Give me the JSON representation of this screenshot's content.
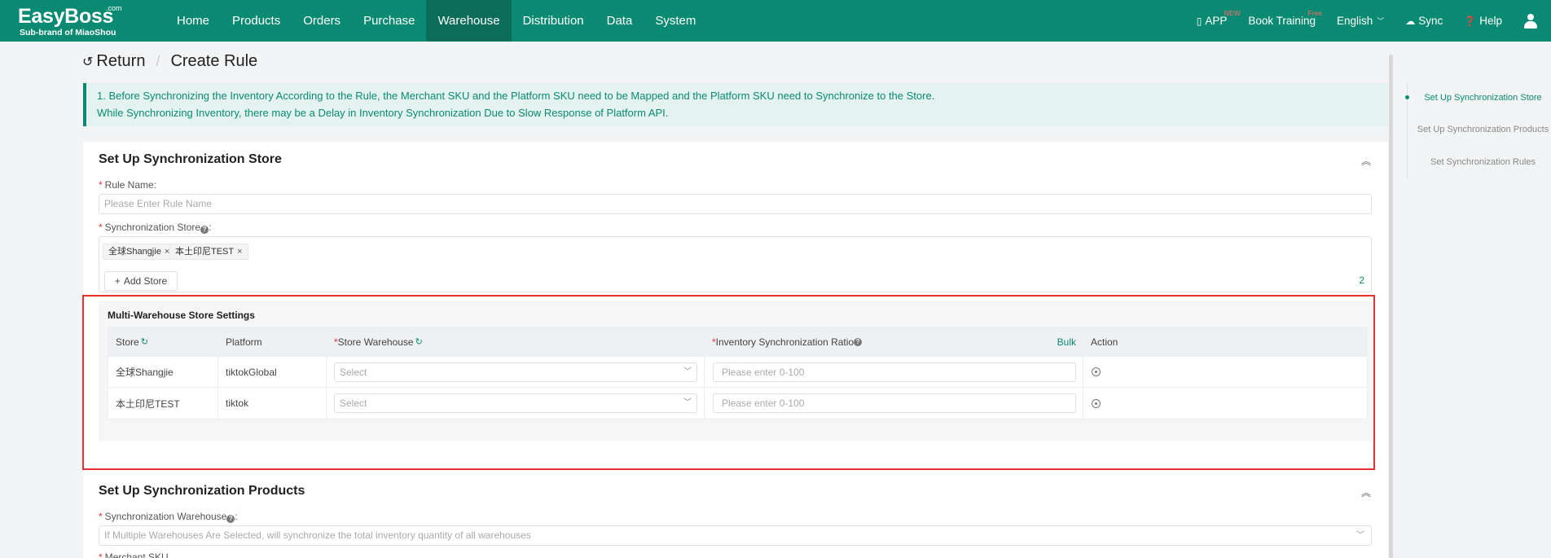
{
  "header": {
    "logo_brand": "EasyBoss",
    "logo_com": ".com",
    "logo_sub": "Sub-brand of MiaoShou",
    "nav": [
      "Home",
      "Products",
      "Orders",
      "Purchase",
      "Warehouse",
      "Distribution",
      "Data",
      "System"
    ],
    "active_nav": "Warehouse",
    "app": "APP",
    "app_badge": "NEW",
    "book_training": "Book Training",
    "book_badge": "Free",
    "language": "English",
    "sync": "Sync",
    "help": "Help"
  },
  "breadcrumb": {
    "return": "Return",
    "sep": "/",
    "current": "Create Rule"
  },
  "notice": {
    "line1": "1. Before Synchronizing the Inventory According to the Rule, the Merchant SKU and the Platform SKU need to be Mapped and the Platform SKU need to Synchronize to the Store.",
    "line2": "While Synchronizing Inventory, there may be a Delay in Inventory Synchronization Due to Slow Response of Platform API."
  },
  "section1": {
    "title": "Set Up Synchronization Store",
    "rule_name_label": "Rule Name:",
    "rule_name_placeholder": "Please Enter Rule Name",
    "store_label": "Synchronization Store",
    "store_label_suffix": ":",
    "tags": [
      "全球Shangjie",
      "本土印尼TEST"
    ],
    "add_store": "Add Store",
    "count": "2",
    "mw_title": "Multi-Warehouse Store Settings",
    "columns": {
      "store": "Store",
      "platform": "Platform",
      "warehouse": "Store Warehouse",
      "ratio": "Inventory Synchronization Ratio",
      "bulk": "Bulk",
      "action": "Action"
    },
    "rows": [
      {
        "store": "全球Shangjie",
        "platform": "tiktokGlobal",
        "select": "Select",
        "ratio_placeholder": "Please enter 0-100"
      },
      {
        "store": "本土印尼TEST",
        "platform": "tiktok",
        "select": "Select",
        "ratio_placeholder": "Please enter 0-100"
      }
    ]
  },
  "section2": {
    "title": "Set Up Synchronization Products",
    "warehouse_label": "Synchronization Warehouse",
    "warehouse_label_suffix": ":",
    "warehouse_placeholder": "If Multiple Warehouses Are Selected, will synchronize the total inventory quantity of all warehouses",
    "merchant_sku_label": "Merchant SKU"
  },
  "side_nav": [
    "Set Up Synchronization Store",
    "Set Up Synchronization Products",
    "Set Synchronization Rules"
  ],
  "colors": {
    "brand": "#0a8a72",
    "highlight": "#e8322d"
  }
}
